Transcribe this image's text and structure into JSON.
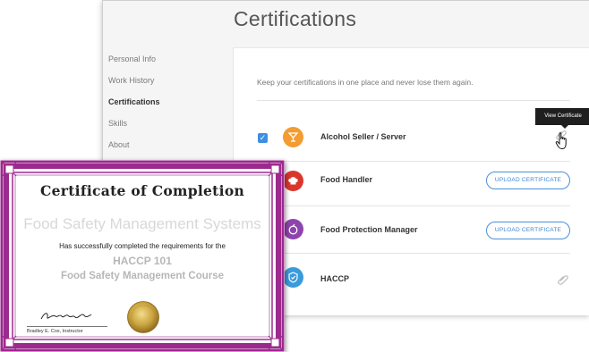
{
  "app": {
    "page_title": "Certifications",
    "sidebar": {
      "items": [
        {
          "label": "Personal Info",
          "active": false
        },
        {
          "label": "Work History",
          "active": false
        },
        {
          "label": "Certifications",
          "active": true
        },
        {
          "label": "Skills",
          "active": false
        },
        {
          "label": "About",
          "active": false
        }
      ]
    },
    "intro_text": "Keep your certifications in one place and never lose them again.",
    "certifications": [
      {
        "name": "Alcohol Seller / Server",
        "checked": true,
        "icon": "cocktail-icon",
        "color": "#f39c32",
        "action": "view-link"
      },
      {
        "name": "Food Handler",
        "checked": false,
        "icon": "chef-hat-icon",
        "color": "#d9372b",
        "action": "upload",
        "button_label": "UPLOAD CERTIFICATE"
      },
      {
        "name": "Food Protection Manager",
        "checked": false,
        "icon": "apple-icon",
        "color": "#8e44ad",
        "action": "upload",
        "button_label": "UPLOAD CERTIFICATE"
      },
      {
        "name": "HACCP",
        "checked": false,
        "icon": "shield-check-icon",
        "color": "#3a9bdc",
        "action": "view-link"
      }
    ],
    "tooltip": "View Certificate"
  },
  "certificate": {
    "heading": "Certificate of Completion",
    "organization": "Food Safety Management Systems",
    "statement": "Has successfully completed the requirements for the",
    "course_code": "HACCP 101",
    "course_name": "Food Safety Management Course",
    "instructor": "Bradley E. Cox, Instructor",
    "border_color": "#9c2a8e"
  },
  "colors": {
    "accent": "#3d8fe0",
    "checkbox": "#3d8fe0"
  }
}
